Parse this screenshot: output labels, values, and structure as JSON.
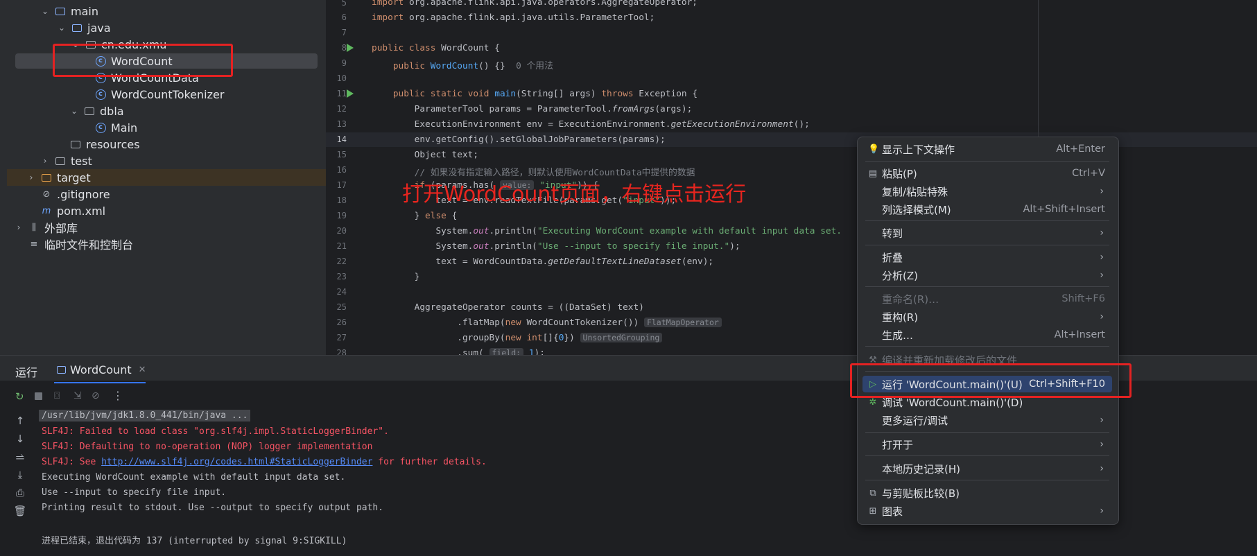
{
  "tree": {
    "items": [
      {
        "label": "main",
        "indent": 3,
        "chev": "⌄",
        "icon": "folder-blue"
      },
      {
        "label": "java",
        "indent": 4,
        "chev": "⌄",
        "icon": "folder-blue"
      },
      {
        "label": "cn.edu.xmu",
        "indent": 5,
        "chev": "⌄",
        "icon": "package"
      },
      {
        "label": "WordCount",
        "indent": 6,
        "chev": "",
        "icon": "class"
      },
      {
        "label": "WordCountData",
        "indent": 6,
        "chev": "",
        "icon": "class"
      },
      {
        "label": "WordCountTokenizer",
        "indent": 6,
        "chev": "",
        "icon": "class"
      },
      {
        "label": "dbla",
        "indent": 5,
        "chev": "⌄",
        "icon": "package"
      },
      {
        "label": "Main",
        "indent": 6,
        "chev": "",
        "icon": "class"
      },
      {
        "label": "resources",
        "indent": 4,
        "chev": "",
        "icon": "folder-plain"
      },
      {
        "label": "test",
        "indent": 3,
        "chev": "›",
        "icon": "folder-plain"
      },
      {
        "label": "target",
        "indent": 2,
        "chev": "›",
        "icon": "folder-orange"
      },
      {
        "label": ".gitignore",
        "indent": 2,
        "chev": "",
        "icon": "gitignore"
      },
      {
        "label": "pom.xml",
        "indent": 2,
        "chev": "",
        "icon": "maven"
      },
      {
        "label": "外部库",
        "indent": 1,
        "chev": "›",
        "icon": "library"
      },
      {
        "label": "临时文件和控制台",
        "indent": 1,
        "chev": "",
        "icon": "scratch"
      }
    ]
  },
  "editor": {
    "line_numbers": [
      "5",
      "6",
      "7",
      "8",
      "9",
      "10",
      "11",
      "12",
      "13",
      "14",
      "15",
      "16",
      "17",
      "18",
      "19",
      "20",
      "21",
      "22",
      "23",
      "24",
      "25",
      "26",
      "27",
      "28"
    ],
    "hints": {
      "usages": "0 个用法",
      "value": "value:",
      "flatmap": "FlatMapOperator",
      "grouping": "UnsortedGrouping",
      "field": "field:"
    },
    "annotation": "打开WordCount页面，右键点击运行"
  },
  "run_panel": {
    "title": "运行",
    "tab": "WordCount",
    "console": [
      {
        "text": "/usr/lib/jvm/jdk1.8.0_441/bin/java ...",
        "kind": "cmd"
      },
      {
        "text": "SLF4J: Failed to load class \"org.slf4j.impl.StaticLoggerBinder\".",
        "kind": "err"
      },
      {
        "text": "SLF4J: Defaulting to no-operation (NOP) logger implementation",
        "kind": "err"
      },
      {
        "text_pre": "SLF4J: See ",
        "link": "http://www.slf4j.org/codes.html#StaticLoggerBinder",
        "text_post": " for further details.",
        "kind": "errlink"
      },
      {
        "text": "Executing WordCount example with default input data set.",
        "kind": "out"
      },
      {
        "text": "Use --input to specify file input.",
        "kind": "out"
      },
      {
        "text": "Printing result to stdout. Use --output to specify output path.",
        "kind": "out"
      },
      {
        "text": "",
        "kind": "out"
      },
      {
        "text": "进程已结束，退出代码为 137 (interrupted by signal 9:SIGKILL)",
        "kind": "out"
      }
    ]
  },
  "context_menu": {
    "items": [
      {
        "label": "显示上下文操作",
        "shortcut": "Alt+Enter",
        "icon": "bulb-icon"
      },
      {
        "label": "粘贴(P)",
        "shortcut": "Ctrl+V",
        "icon": "paste-icon"
      },
      {
        "label": "复制/粘贴特殊",
        "submenu": true
      },
      {
        "label": "列选择模式(M)",
        "shortcut": "Alt+Shift+Insert"
      },
      {
        "label": "转到",
        "submenu": true
      },
      {
        "label": "折叠",
        "submenu": true
      },
      {
        "label": "分析(Z)",
        "submenu": true
      },
      {
        "label": "重命名(R)…",
        "shortcut": "Shift+F6",
        "disabled": true
      },
      {
        "label": "重构(R)",
        "submenu": true
      },
      {
        "label": "生成…",
        "shortcut": "Alt+Insert"
      },
      {
        "label": "编译并重新加载修改后的文件",
        "disabled": true,
        "icon": "hammer-icon"
      },
      {
        "label": "运行 'WordCount.main()'(U)",
        "shortcut": "Ctrl+Shift+F10",
        "icon": "run-icon",
        "highlight": true
      },
      {
        "label": "调试 'WordCount.main()'(D)",
        "icon": "debug-icon"
      },
      {
        "label": "更多运行/调试",
        "submenu": true
      },
      {
        "label": "打开于",
        "submenu": true
      },
      {
        "label": "本地历史记录(H)",
        "submenu": true
      },
      {
        "label": "与剪贴板比较(B)",
        "icon": "compare-icon"
      },
      {
        "label": "图表",
        "submenu": true,
        "icon": "diagram-icon"
      }
    ]
  },
  "colors": {
    "accent_red": "#e42222",
    "highlight": "#2e436e"
  }
}
